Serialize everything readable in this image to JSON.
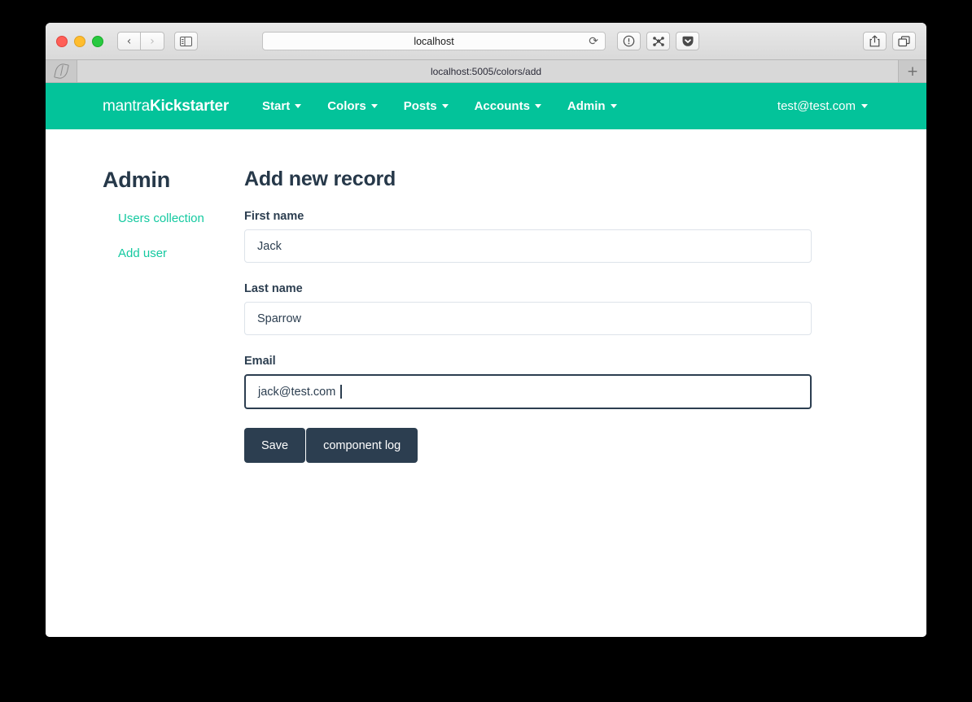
{
  "browser": {
    "window_controls": [
      "close",
      "minimize",
      "maximize"
    ],
    "back_label": "‹",
    "forward_label": "›",
    "sidebar_icon": "sidebar-icon",
    "address": "localhost",
    "reload_label": "⟳",
    "toolbar_icons": [
      "info-circle-icon",
      "share-nodes-icon",
      "pocket-icon"
    ],
    "right_icons": [
      "share-icon",
      "tabs-icon"
    ],
    "bookmark_favicon": "leaf-icon",
    "bookmark_url": "localhost:5005/colors/add",
    "newtab_label": "+"
  },
  "navbar": {
    "brand_light": "mantra",
    "brand_bold": "Kickstarter",
    "items": [
      {
        "label": "Start"
      },
      {
        "label": "Colors"
      },
      {
        "label": "Posts"
      },
      {
        "label": "Accounts"
      },
      {
        "label": "Admin"
      }
    ],
    "account": "test@test.com",
    "background": "#03c39a"
  },
  "sidebar": {
    "title": "Admin",
    "links": [
      {
        "label": "Users collection"
      },
      {
        "label": "Add user"
      }
    ],
    "link_color": "#14c9a0"
  },
  "form": {
    "title": "Add new record",
    "fields": [
      {
        "label": "First name",
        "value": "Jack",
        "placeholder": "First name"
      },
      {
        "label": "Last name",
        "value": "Sparrow",
        "placeholder": "Last name"
      },
      {
        "label": "Email",
        "value": "jack@test.com",
        "placeholder": "Email"
      }
    ],
    "save_label": "Save",
    "log_label": "component log",
    "button_color": "#2c3e50"
  }
}
